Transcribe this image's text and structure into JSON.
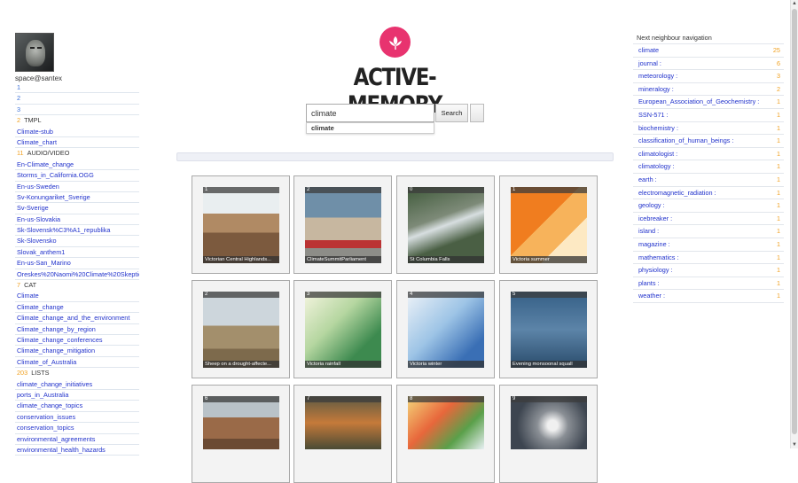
{
  "user": {
    "name": "space@santex"
  },
  "left": {
    "pages": [
      "1",
      "2",
      "3"
    ],
    "groups": [
      {
        "count": "2",
        "label": "TMPL",
        "items": [
          "Climate-stub",
          "Climate_chart"
        ]
      },
      {
        "count": "11",
        "label": "AUDIO/VIDEO",
        "items": [
          "En-Climate_change",
          "Storms_in_California.OGG",
          "En-us-Sweden",
          "Sv-Konungariket_Sverige",
          "Sv-Sverige",
          "En-us-Slovakia",
          "Sk-Slovensk%C3%A1_republika",
          "Sk-Slovensko",
          "Slovak_anthem1",
          "En-us-San_Marino",
          "Oreskes%20Naomi%20Climate%20Skeptics"
        ]
      },
      {
        "count": "7",
        "label": "CAT",
        "items": [
          "Climate",
          "Climate_change",
          "Climate_change_and_the_environment",
          "Climate_change_by_region",
          "Climate_change_conferences",
          "Climate_change_mitigation",
          "Climate_of_Australia"
        ]
      },
      {
        "count": "203",
        "label": "LISTS",
        "items": [
          "climate_change_initiatives",
          "ports_in_Australia",
          "climate_change_topics",
          "conservation_issues",
          "conservation_topics",
          "environmental_agreements",
          "environmental_health_hazards"
        ]
      }
    ]
  },
  "brand": {
    "name": "ACTIVE-MEMORY"
  },
  "search": {
    "value": "climate",
    "button": "Search",
    "suggestion": "climate"
  },
  "tiles": [
    {
      "num": "1",
      "caption": "Victorian Central Highlands..."
    },
    {
      "num": "2",
      "caption": "ClimateSummitParliament"
    },
    {
      "num": "0",
      "caption": "St Columbia Falls"
    },
    {
      "num": "1",
      "caption": "Victoria summer"
    },
    {
      "num": "2",
      "caption": "Sheep on a drought-affecte..."
    },
    {
      "num": "3",
      "caption": "Victoria rainfall"
    },
    {
      "num": "4",
      "caption": "Victoria winter"
    },
    {
      "num": "5",
      "caption": "Evening monsoonal squall"
    },
    {
      "num": "6",
      "caption": ""
    },
    {
      "num": "7",
      "caption": ""
    },
    {
      "num": "8",
      "caption": ""
    },
    {
      "num": "9",
      "caption": ""
    }
  ],
  "right": {
    "title": "Next neighbour navigation",
    "items": [
      {
        "label": "climate",
        "count": "25"
      },
      {
        "label": "journal :",
        "count": "6"
      },
      {
        "label": "meteorology :",
        "count": "3"
      },
      {
        "label": "mineralogy :",
        "count": "2"
      },
      {
        "label": "European_Association_of_Geochemistry :",
        "count": "1"
      },
      {
        "label": "SSN-571 :",
        "count": "1"
      },
      {
        "label": "biochemistry :",
        "count": "1"
      },
      {
        "label": "classification_of_human_beings :",
        "count": "1"
      },
      {
        "label": "climatologist :",
        "count": "1"
      },
      {
        "label": "climatology :",
        "count": "1"
      },
      {
        "label": "earth :",
        "count": "1"
      },
      {
        "label": "electromagnetic_radiation :",
        "count": "1"
      },
      {
        "label": "geology :",
        "count": "1"
      },
      {
        "label": "icebreaker :",
        "count": "1"
      },
      {
        "label": "island :",
        "count": "1"
      },
      {
        "label": "magazine :",
        "count": "1"
      },
      {
        "label": "mathematics :",
        "count": "1"
      },
      {
        "label": "physiology :",
        "count": "1"
      },
      {
        "label": "plants :",
        "count": "1"
      },
      {
        "label": "weather :",
        "count": "1"
      }
    ]
  },
  "colors": {
    "accent": "#e8336f",
    "link": "#2233cc",
    "count": "#f0a020"
  },
  "icons": {
    "logo": "lotus-icon"
  }
}
